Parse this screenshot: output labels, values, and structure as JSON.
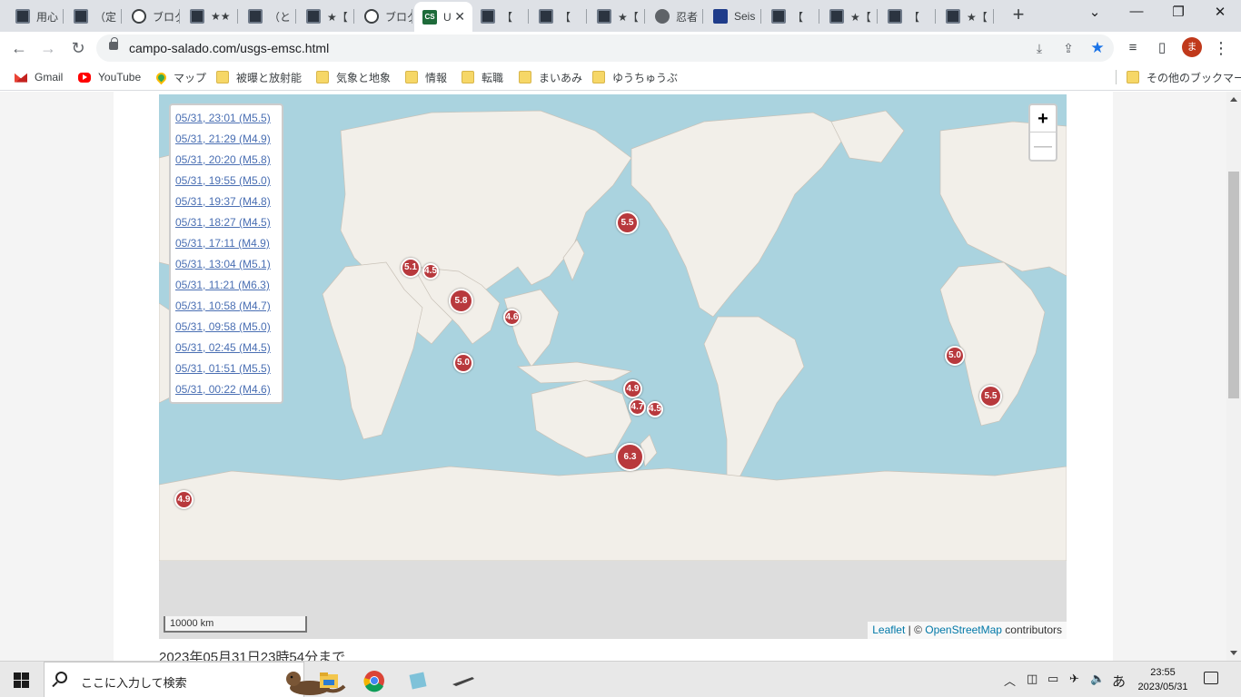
{
  "tabs": [
    {
      "title": "用心",
      "icon": "dark"
    },
    {
      "title": "（定",
      "icon": "dark"
    },
    {
      "title": "ブログ",
      "icon": "ring"
    },
    {
      "title": "★★",
      "icon": "dark"
    },
    {
      "title": "（と",
      "icon": "dark"
    },
    {
      "title": "★【",
      "icon": "dark"
    },
    {
      "title": "ブログ",
      "icon": "ring"
    },
    {
      "title": "U",
      "icon": "cs",
      "active": true
    },
    {
      "title": "【",
      "icon": "dark"
    },
    {
      "title": "【",
      "icon": "dark"
    },
    {
      "title": "★【",
      "icon": "dark"
    },
    {
      "title": "忍者",
      "icon": "globe"
    },
    {
      "title": "Seis",
      "icon": "seis"
    },
    {
      "title": "【",
      "icon": "dark"
    },
    {
      "title": "★【",
      "icon": "dark"
    },
    {
      "title": "【",
      "icon": "dark"
    },
    {
      "title": "★【",
      "icon": "dark"
    }
  ],
  "active_tab_close": "✕",
  "new_tab": "+",
  "window": {
    "dropdown": "⌄",
    "minimize": "—",
    "restore": "❐",
    "close": "✕"
  },
  "toolbar": {
    "url": "campo-salado.com/usgs-emsc.html",
    "back": "←",
    "forward": "→",
    "reload": "↻",
    "avatar_letter": "ま",
    "menu": "⋮"
  },
  "bookmarks": [
    {
      "label": "Gmail",
      "icon": "gmail"
    },
    {
      "label": "YouTube",
      "icon": "yt"
    },
    {
      "label": "マップ",
      "icon": "maps"
    },
    {
      "label": "被曝と放射能",
      "icon": "folder"
    },
    {
      "label": "気象と地象",
      "icon": "folder"
    },
    {
      "label": "情報",
      "icon": "folder"
    },
    {
      "label": "転職",
      "icon": "folder"
    },
    {
      "label": "まいあみ",
      "icon": "folder"
    },
    {
      "label": "ゆうちゅうぶ",
      "icon": "folder"
    }
  ],
  "other_bookmarks": "その他のブックマーク",
  "events": [
    "05/31, 23:01 (M5.5)",
    "05/31, 21:29 (M4.9)",
    "05/31, 20:20 (M5.8)",
    "05/31, 19:55 (M5.0)",
    "05/31, 19:37 (M4.8)",
    "05/31, 18:27 (M4.5)",
    "05/31, 17:11 (M4.9)",
    "05/31, 13:04 (M5.1)",
    "05/31, 11:21 (M6.3)",
    "05/31, 10:58 (M4.7)",
    "05/31, 09:58 (M5.0)",
    "05/31, 02:45 (M4.5)",
    "05/31, 01:51 (M5.5)",
    "05/31, 00:22 (M4.6)"
  ],
  "markers": [
    {
      "mag": "5.5",
      "lat": 50,
      "lon": 156
    },
    {
      "mag": "5.1",
      "lat": 37,
      "lon": 70
    },
    {
      "mag": "4.5",
      "lat": 36,
      "lon": 78
    },
    {
      "mag": "5.8",
      "lat": 26,
      "lon": 90
    },
    {
      "mag": "4.6",
      "lat": 20,
      "lon": 110
    },
    {
      "mag": "5.0",
      "lat": 2,
      "lon": 91
    },
    {
      "mag": "4.9",
      "lat": -8,
      "lon": 158
    },
    {
      "mag": "4.7",
      "lat": -15,
      "lon": 160
    },
    {
      "mag": "4.5",
      "lat": -16,
      "lon": 167
    },
    {
      "mag": "6.3",
      "lat": -33,
      "lon": 157
    },
    {
      "mag": "5.0",
      "lat": 5,
      "lon": -74
    },
    {
      "mag": "5.5",
      "lat": -11,
      "lon": -60
    },
    {
      "mag": "4.9",
      "lat": -46,
      "lon": -20
    }
  ],
  "map": {
    "zoom_in": "+",
    "zoom_out": "—",
    "scale": "10000 km",
    "attribution_leaflet": "Leaflet",
    "attribution_sep": " | © ",
    "attribution_osm": "OpenStreetMap",
    "attribution_tail": " contributors"
  },
  "updated_text": "2023年05月31日23時54分まで",
  "taskbar": {
    "search_placeholder": "ここに入力して検索",
    "time": "23:55",
    "date": "2023/05/31",
    "ime": "あ"
  }
}
